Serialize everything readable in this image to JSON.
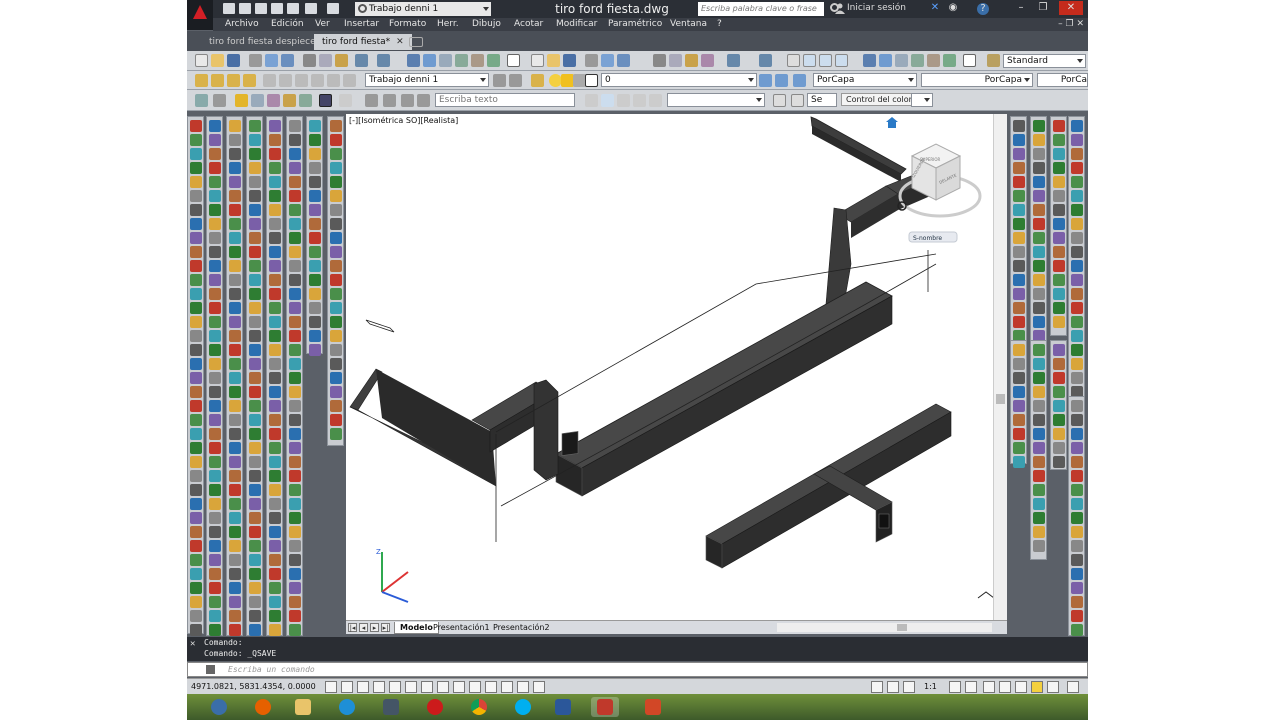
{
  "titlebar": {
    "workspace": "Trabajo denni 1",
    "document_title": "tiro ford fiesta.dwg",
    "search_placeholder": "Escriba palabra clave o frase",
    "sign_in": "Iniciar sesión",
    "help": "?"
  },
  "menu": [
    "Archivo",
    "Edición",
    "Ver",
    "Insertar",
    "Formato",
    "Herr.",
    "Dibujo",
    "Acotar",
    "Modificar",
    "Paramétrico",
    "Ventana",
    "?"
  ],
  "tabs": [
    {
      "label": "tiro ford fiesta despiece",
      "active": false
    },
    {
      "label": "tiro ford fiesta*",
      "active": true
    }
  ],
  "toolbar": {
    "text_style": "Standard",
    "workspace_combo": "Trabajo denni 1",
    "layer": "0",
    "color": "PorCapa",
    "linetype": "PorCapa",
    "lineweight": "PorCa",
    "text_input_placeholder": "Escriba texto",
    "tooltip": "Control del color",
    "dim_combo": "Se"
  },
  "viewport": {
    "label": "[-][Isométrica SO][Realista]",
    "viewcube_label": "S-nombre",
    "viewcube_faces": [
      "SUPERIOR",
      "IZQUIERDA",
      "DELANTE"
    ]
  },
  "layouts": [
    "Modelo",
    "Presentación1",
    "Presentación2"
  ],
  "command": {
    "history": [
      "Comando:",
      "Comando:  _QSAVE"
    ],
    "placeholder": "Escriba un comando"
  },
  "status": {
    "coordinates": "4971.0821, 5831.4354, 0.0000",
    "scale": "1:1"
  },
  "colors": {
    "model": "#353535",
    "accent": "#d31f26"
  },
  "taskbar": [
    "firefox-icon",
    "file-explorer-icon",
    "internet-explorer-icon",
    "calculator-icon",
    "opera-icon",
    "chrome-icon",
    "skype-icon",
    "word-icon",
    "autocad-icon",
    "powerpoint-icon"
  ]
}
